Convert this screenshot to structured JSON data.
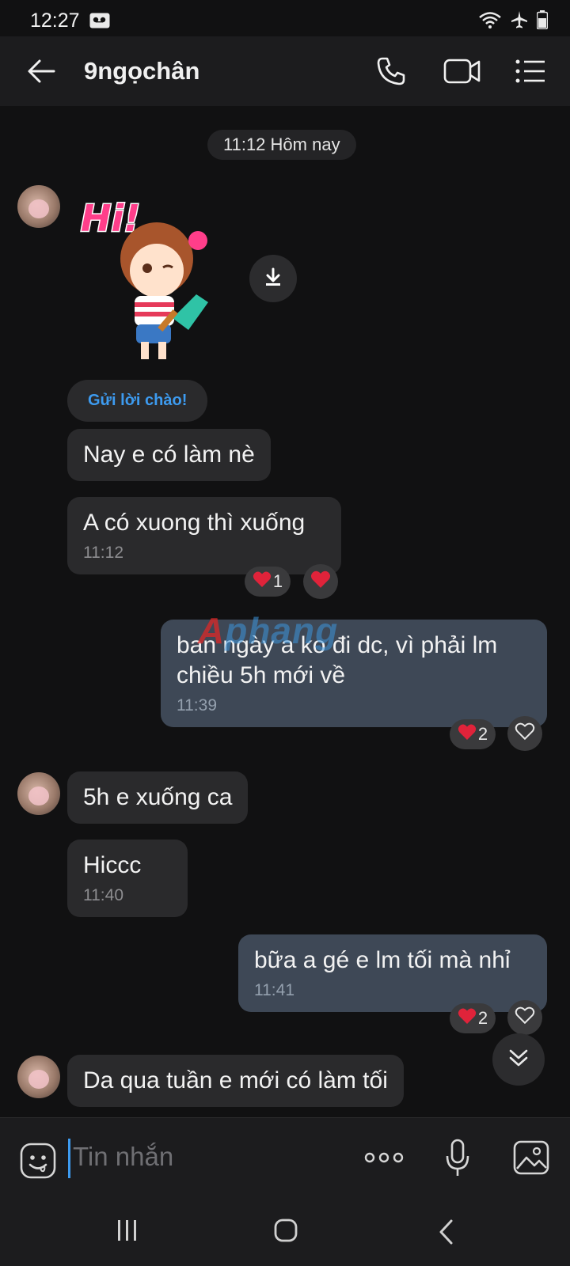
{
  "status_bar": {
    "time": "12:27",
    "icons": [
      "voicemail-icon",
      "wifi-icon",
      "airplane-mode-icon",
      "battery-icon"
    ]
  },
  "header": {
    "title": "9ngọchân",
    "icons": [
      "back-arrow-icon",
      "phone-icon",
      "video-call-icon",
      "list-menu-icon"
    ]
  },
  "conversation": {
    "date_separator": "11:12 Hôm nay",
    "greet_label": "Gửi lời chào!",
    "sticker_text": "Hi!",
    "messages": [
      {
        "text": "Nay e có làm nè"
      },
      {
        "text": "A có xuong thì xuống",
        "time": "11:12",
        "reactions": "1"
      },
      {
        "text": "ban ngày a ko đi dc, vì phải lm",
        "text2": "chiều 5h mới về",
        "time": "11:39",
        "reactions": "2"
      },
      {
        "text": "5h e xuống ca"
      },
      {
        "text": "Hiccc",
        "time": "11:40"
      },
      {
        "text": "bữa a gé e lm tối mà nhỉ",
        "time": "11:41",
        "reactions": "2"
      },
      {
        "text": "Da qua tuần e mới có làm tối"
      }
    ],
    "watermark": {
      "first": "A",
      "rest": "phang"
    }
  },
  "input_bar": {
    "placeholder": "Tin nhắn",
    "icons": [
      "emoji-sticker-icon",
      "more-options-icon",
      "microphone-icon",
      "gallery-icon"
    ]
  },
  "colors": {
    "background": "#111112",
    "bar": "#1c1c1e",
    "incoming_bubble": "#2a2a2c",
    "outgoing_bubble": "#3e4856",
    "accent": "#3d9bf0",
    "heart": "#e0233a"
  }
}
